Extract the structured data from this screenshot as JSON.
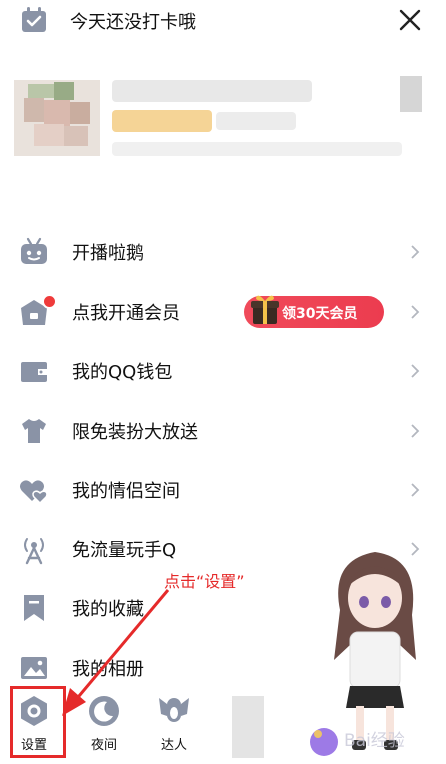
{
  "header": {
    "checkin_text": "今天还没打卡哦",
    "checkin_icon": "calendar-icon",
    "close_icon": "close-icon"
  },
  "menu": {
    "items": [
      {
        "label": "开播啦鹅",
        "icon": "tv-robot-icon"
      },
      {
        "label": "点我开通会员",
        "icon": "shop-basket-icon",
        "badge": "领30天会员"
      },
      {
        "label": "我的QQ钱包",
        "icon": "wallet-icon"
      },
      {
        "label": "限免装扮大放送",
        "icon": "tshirt-icon"
      },
      {
        "label": "我的情侣空间",
        "icon": "double-heart-icon"
      },
      {
        "label": "免流量玩手Q",
        "icon": "signal-tower-icon"
      },
      {
        "label": "我的收藏",
        "icon": "bookmark-icon"
      },
      {
        "label": "我的相册",
        "icon": "photo-album-icon"
      }
    ]
  },
  "bottom_bar": {
    "settings_label": "设置",
    "night_label": "夜间",
    "expert_label": "达人"
  },
  "annotation": {
    "text": "点击“设置”"
  },
  "colors": {
    "icon_gray": "#8a93a6",
    "accent_red": "#e52a2a",
    "badge_red": "#ef3f52"
  }
}
